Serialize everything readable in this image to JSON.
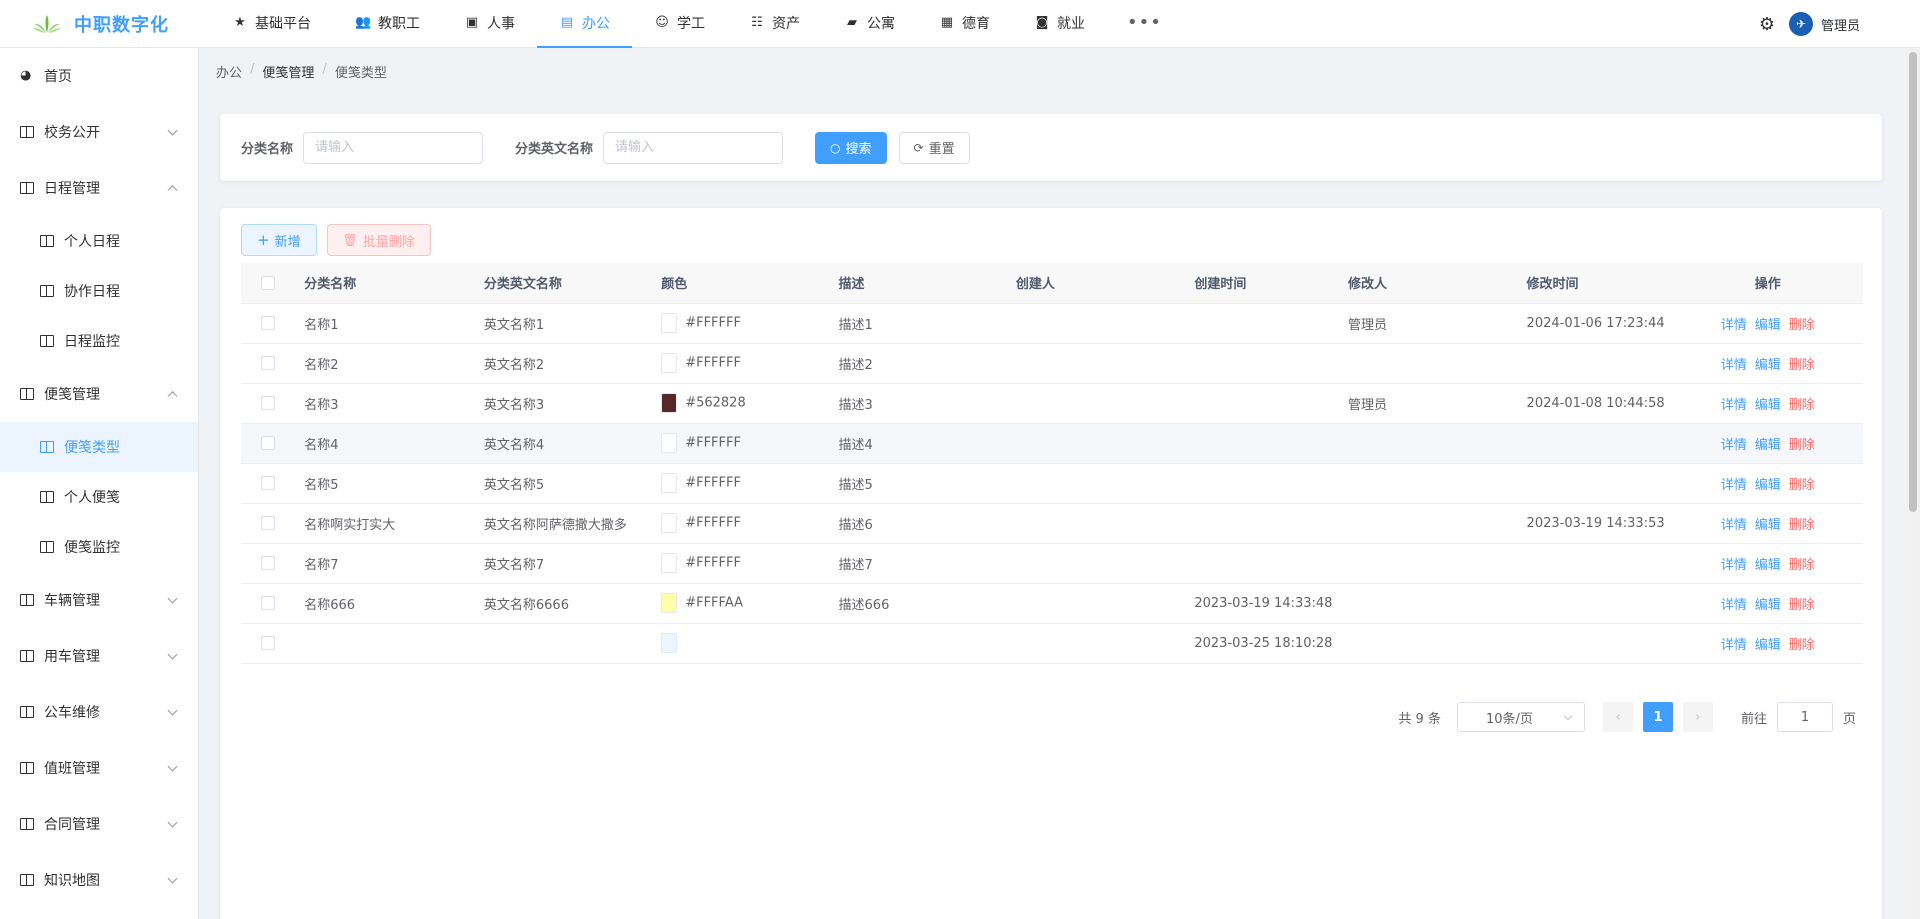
{
  "app": {
    "title": "中职数字化",
    "brand_color": "#409eff"
  },
  "topnav": [
    {
      "label": "基础平台",
      "icon": "star-icon"
    },
    {
      "label": "教职工",
      "icon": "people-icon"
    },
    {
      "label": "人事",
      "icon": "image-icon"
    },
    {
      "label": "办公",
      "icon": "office-icon",
      "active": true
    },
    {
      "label": "学工",
      "icon": "student-icon"
    },
    {
      "label": "资产",
      "icon": "tree-icon"
    },
    {
      "label": "公寓",
      "icon": "folder-icon"
    },
    {
      "label": "德育",
      "icon": "grid-icon"
    },
    {
      "label": "就业",
      "icon": "badge-icon"
    }
  ],
  "user": {
    "name": "管理员"
  },
  "sidebar": {
    "home": "首页",
    "groups": [
      {
        "label": "校务公开"
      },
      {
        "label": "日程管理",
        "children": [
          "个人日程",
          "协作日程",
          "日程监控"
        ]
      },
      {
        "label": "便笺管理",
        "children": [
          "便笺类型",
          "个人便笺",
          "便笺监控"
        ]
      },
      {
        "label": "车辆管理"
      },
      {
        "label": "用车管理"
      },
      {
        "label": "公车维修"
      },
      {
        "label": "值班管理"
      },
      {
        "label": "合同管理"
      },
      {
        "label": "知识地图"
      }
    ],
    "active_item": "便笺类型"
  },
  "breadcrumb": [
    "办公",
    "便笺管理",
    "便笺类型"
  ],
  "search": {
    "name_label": "分类名称",
    "name_placeholder": "请输入",
    "en_label": "分类英文名称",
    "en_placeholder": "请输入",
    "search_button": "搜索",
    "reset_button": "重置"
  },
  "toolbar": {
    "add_button": "新增",
    "batch_delete_button": "批量删除"
  },
  "table": {
    "columns": [
      "分类名称",
      "分类英文名称",
      "颜色",
      "描述",
      "创建人",
      "创建时间",
      "修改人",
      "修改时间",
      "操作"
    ],
    "rows": [
      {
        "name": "名称1",
        "en": "英文名称1",
        "color": "#FFFFFF",
        "desc": "描述1",
        "creator": "",
        "created": "",
        "modifier": "管理员",
        "modified": "2024-01-06 17:23:44"
      },
      {
        "name": "名称2",
        "en": "英文名称2",
        "color": "#FFFFFF",
        "desc": "描述2",
        "creator": "",
        "created": "",
        "modifier": "",
        "modified": ""
      },
      {
        "name": "名称3",
        "en": "英文名称3",
        "color": "#562828",
        "desc": "描述3",
        "creator": "",
        "created": "",
        "modifier": "管理员",
        "modified": "2024-01-08 10:44:58"
      },
      {
        "name": "名称4",
        "en": "英文名称4",
        "color": "#FFFFFF",
        "desc": "描述4",
        "creator": "",
        "created": "",
        "modifier": "",
        "modified": ""
      },
      {
        "name": "名称5",
        "en": "英文名称5",
        "color": "#FFFFFF",
        "desc": "描述5",
        "creator": "",
        "created": "",
        "modifier": "",
        "modified": ""
      },
      {
        "name": "名称啊实打实大",
        "en": "英文名称阿萨德撒大撒多",
        "color": "#FFFFFF",
        "desc": "描述6",
        "creator": "",
        "created": "",
        "modifier": "",
        "modified": "2023-03-19 14:33:53"
      },
      {
        "name": "名称7",
        "en": "英文名称7",
        "color": "#FFFFFF",
        "desc": "描述7",
        "creator": "",
        "created": "",
        "modifier": "",
        "modified": ""
      },
      {
        "name": "名称666",
        "en": "英文名称6666",
        "color": "#FFFFAA",
        "desc": "描述666",
        "creator": "",
        "created": "2023-03-19 14:33:48",
        "modifier": "",
        "modified": ""
      },
      {
        "name": "",
        "en": "",
        "color": "",
        "swatch": "#ecf5ff",
        "desc": "",
        "creator": "",
        "created": "2023-03-25 18:10:28",
        "modifier": "",
        "modified": ""
      }
    ],
    "actions": {
      "detail": "详情",
      "edit": "编辑",
      "delete": "删除"
    }
  },
  "pagination": {
    "total_text": "共 9 条",
    "page_size": "10条/页",
    "current_page": "1",
    "goto_label": "前往",
    "goto_value": "1",
    "page_suffix": "页"
  }
}
